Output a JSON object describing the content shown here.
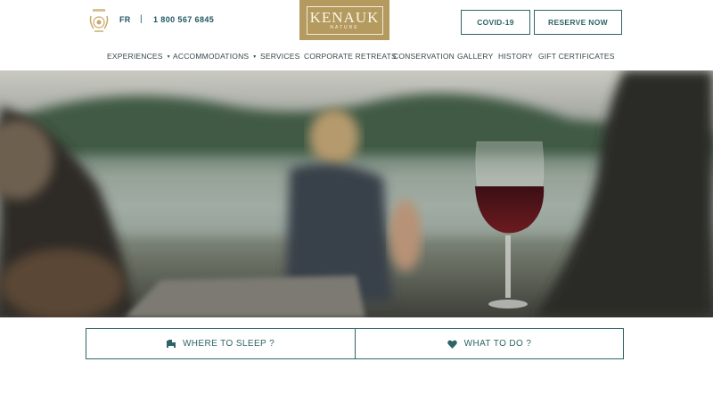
{
  "header": {
    "award_icon": "laurel-award-icon",
    "award_text": [
      "Travellers'",
      "Choice",
      "2020"
    ],
    "language": "FR",
    "separator": "|",
    "phone": "1 800 567 6845",
    "logo_main": "KENAUK",
    "logo_sub": "NATURE",
    "covid_button": "COVID-19",
    "reserve_button": "RESERVE NOW"
  },
  "nav": {
    "items": [
      {
        "label": "EXPERIENCES",
        "has_dropdown": true
      },
      {
        "label": "ACCOMMODATIONS",
        "has_dropdown": true
      },
      {
        "label": "SERVICES",
        "has_dropdown": false
      },
      {
        "label": "CORPORATE RETREATS",
        "has_dropdown": false
      },
      {
        "label": "CONSERVATION",
        "has_dropdown": false
      },
      {
        "label": "GALLERY",
        "has_dropdown": false
      },
      {
        "label": "HISTORY",
        "has_dropdown": false
      },
      {
        "label": "GIFT CERTIFICATES",
        "has_dropdown": false
      }
    ],
    "dropdown_glyph": "▼"
  },
  "hero": {
    "description": "Dusk by a lake, glass of red wine on a wooden dock"
  },
  "cta": {
    "sleep_label": "WHERE TO SLEEP ?",
    "sleep_icon": "bed-icon",
    "do_label": "WHAT TO DO ?",
    "do_icon": "heart-icon"
  },
  "colors": {
    "brand_teal": "#2e6468",
    "logo_gold": "#b49a5e",
    "nav_text": "#36484a"
  }
}
